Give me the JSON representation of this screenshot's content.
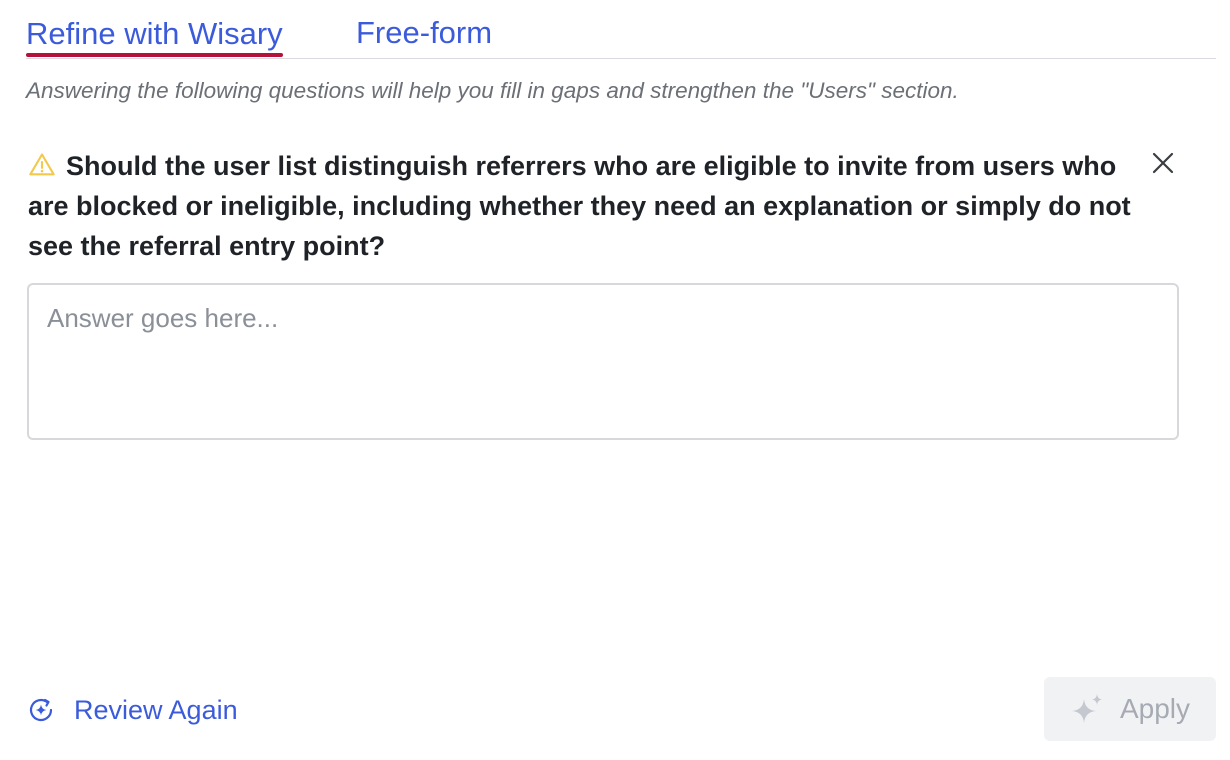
{
  "tabs": [
    {
      "label": "Refine with Wisary",
      "active": true
    },
    {
      "label": "Free-form",
      "active": false
    }
  ],
  "helper_text": "Answering the following questions will help you fill in gaps and strengthen the \"Users\" section.",
  "question": {
    "icon": "warning-icon",
    "text": "Should the user list distinguish referrers who are eligible to invite from users who are blocked or ineligible, including whether they need an explanation or simply do not see the referral entry point?"
  },
  "answer": {
    "value": "",
    "placeholder": "Answer goes here..."
  },
  "actions": {
    "review_again_label": "Review Again",
    "apply_label": "Apply",
    "apply_enabled": false
  },
  "colors": {
    "accent": "#3b5bdb",
    "active_tab_underline": "#b3123a",
    "warning": "#f2c94c",
    "disabled_text": "#a6abb3"
  }
}
